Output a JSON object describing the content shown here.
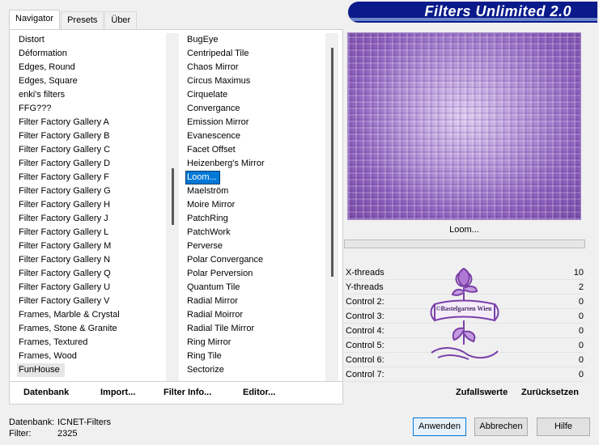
{
  "tabs": [
    "Navigator",
    "Presets",
    "Über"
  ],
  "banner_title": "Filters Unlimited 2.0",
  "categories": [
    "Distort",
    "Déformation",
    "Edges, Round",
    "Edges, Square",
    "enki's filters",
    "FFG???",
    "Filter Factory Gallery A",
    "Filter Factory Gallery B",
    "Filter Factory Gallery C",
    "Filter Factory Gallery D",
    "Filter Factory Gallery F",
    "Filter Factory Gallery G",
    "Filter Factory Gallery H",
    "Filter Factory Gallery J",
    "Filter Factory Gallery L",
    "Filter Factory Gallery M",
    "Filter Factory Gallery N",
    "Filter Factory Gallery Q",
    "Filter Factory Gallery U",
    "Filter Factory Gallery V",
    "Frames, Marble & Crystal",
    "Frames, Stone & Granite",
    "Frames, Textured",
    "Frames, Wood",
    "FunHouse"
  ],
  "selected_category": "FunHouse",
  "filters": [
    "BugEye",
    "Centripedal Tile",
    "Chaos Mirror",
    "Circus Maximus",
    "Cirquelate",
    "Convergance",
    "Emission Mirror",
    "Evanescence",
    "Facet Offset",
    "Heizenberg's Mirror",
    "Loom...",
    "Maelström",
    "Moire Mirror",
    "PatchRing",
    "PatchWork",
    "Perverse",
    "Polar Convergance",
    "Polar Perversion",
    "Quantum Tile",
    "Radial Mirror",
    "Radial Moirror",
    "Radial Tile Mirror",
    "Ring Mirror",
    "Ring Tile",
    "Sectorize"
  ],
  "selected_filter": "Loom...",
  "preview_label": "Loom...",
  "params": [
    {
      "label": "X-threads",
      "value": "10"
    },
    {
      "label": "Y-threads",
      "value": "2"
    },
    {
      "label": "Control 2:",
      "value": "0"
    },
    {
      "label": "Control 3:",
      "value": "0"
    },
    {
      "label": "Control 4:",
      "value": "0"
    },
    {
      "label": "Control 5:",
      "value": "0"
    },
    {
      "label": "Control 6:",
      "value": "0"
    },
    {
      "label": "Control 7:",
      "value": "0"
    }
  ],
  "watermark_text": "©Bastelgarten Wien",
  "bottom_buttons": {
    "datenbank": "Datenbank",
    "import": "Import...",
    "filter_info": "Filter Info...",
    "editor": "Editor...",
    "zufallswerte": "Zufallswerte",
    "zuruecksetzen": "Zurücksetzen"
  },
  "footer": {
    "datenbank_label": "Datenbank:",
    "datenbank_value": "ICNET-Filters",
    "filter_label": "Filter:",
    "filter_value": "2325"
  },
  "dialog_buttons": {
    "apply": "Anwenden",
    "cancel": "Abbrechen",
    "help": "Hilfe"
  }
}
